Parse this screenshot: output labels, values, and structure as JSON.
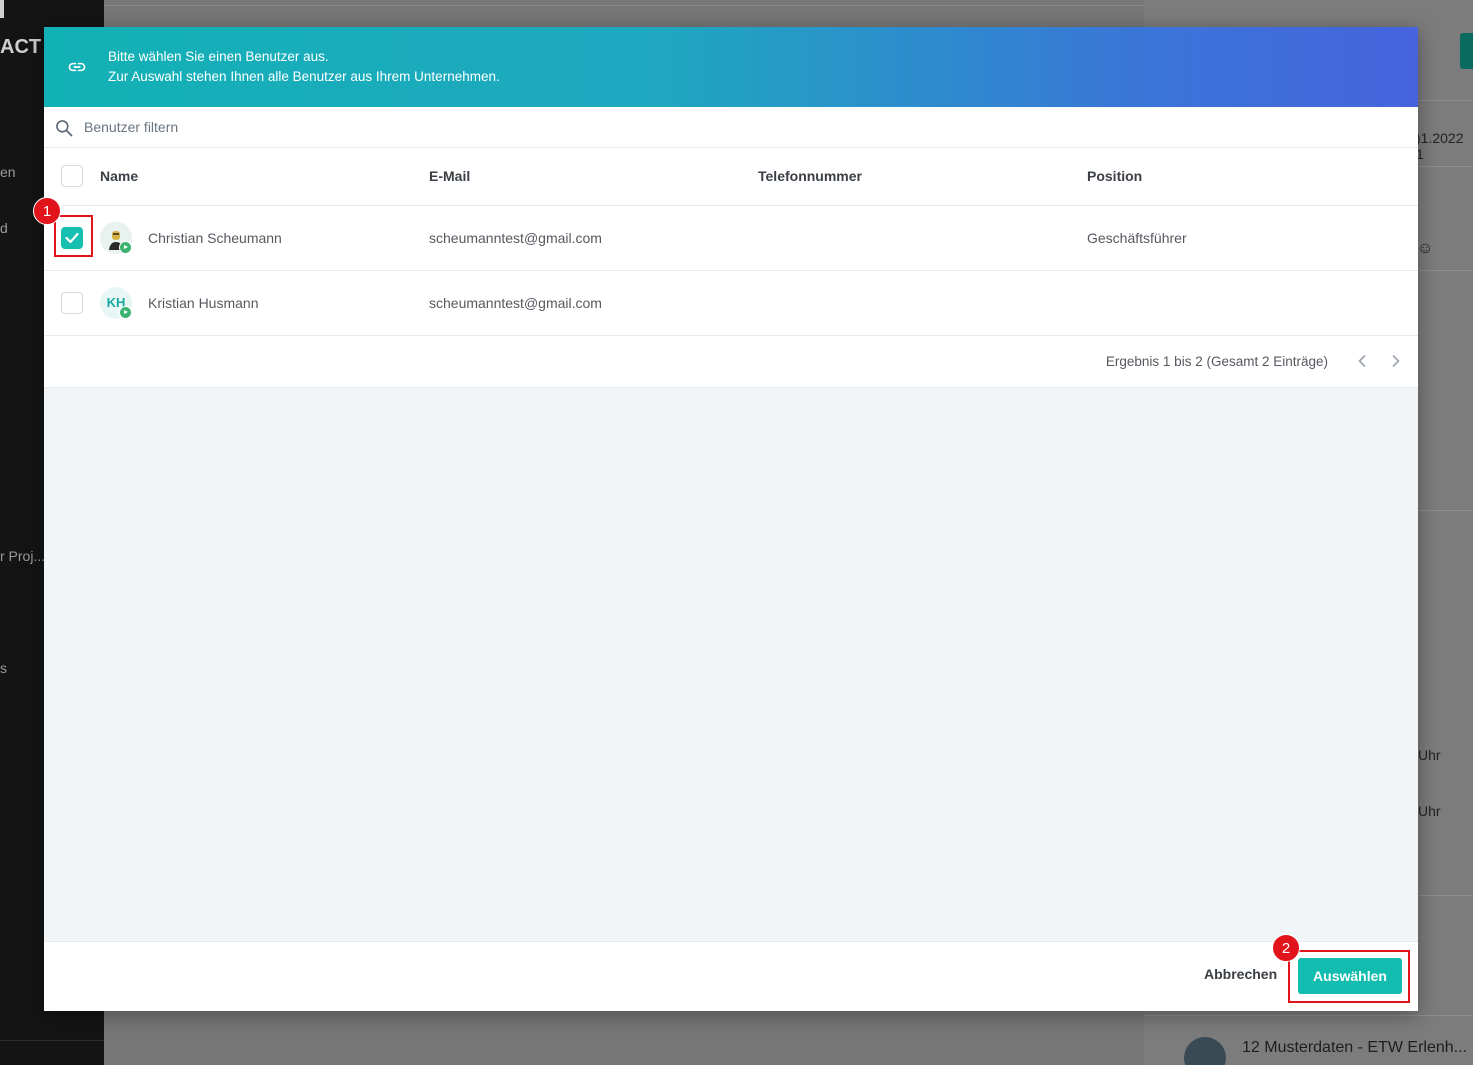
{
  "background": {
    "logo_text": "ACT",
    "sidebar_items": [
      "en",
      "d",
      "r Proj...",
      "s"
    ],
    "right_panel": {
      "date_text": ")1.2022 1",
      "emoji": "☺",
      "time1": "Uhr",
      "time2": "Uhr",
      "project_title": "12 Musterdaten - ETW Erlenh..."
    }
  },
  "modal": {
    "header": {
      "icon": "link-icon",
      "line1": "Bitte wählen Sie einen Benutzer aus.",
      "line2": "Zur Auswahl stehen Ihnen alle Benutzer aus Ihrem Unternehmen."
    },
    "search": {
      "icon": "search-icon",
      "placeholder": "Benutzer filtern",
      "value": ""
    },
    "table": {
      "columns": [
        "Name",
        "E-Mail",
        "Telefonnummer",
        "Position"
      ],
      "rows": [
        {
          "checked": true,
          "avatar": "photo",
          "name": "Christian Scheumann",
          "email": "scheumanntest@gmail.com",
          "phone": "",
          "position": "Geschäftsführer"
        },
        {
          "checked": false,
          "avatar_initials": "KH",
          "name": "Kristian Husmann",
          "email": "scheumanntest@gmail.com",
          "phone": "",
          "position": ""
        }
      ]
    },
    "pagination": {
      "info": "Ergebnis 1 bis 2 (Gesamt 2 Einträge)"
    },
    "footer": {
      "cancel_label": "Abbrechen",
      "select_label": "Auswählen"
    }
  },
  "annotations": {
    "marker1": "1",
    "marker2": "2"
  },
  "colors": {
    "accent": "#12bcae",
    "header_gradient_start": "#12b1b5",
    "header_gradient_end": "#4664dc",
    "marker": "#e0141a"
  }
}
